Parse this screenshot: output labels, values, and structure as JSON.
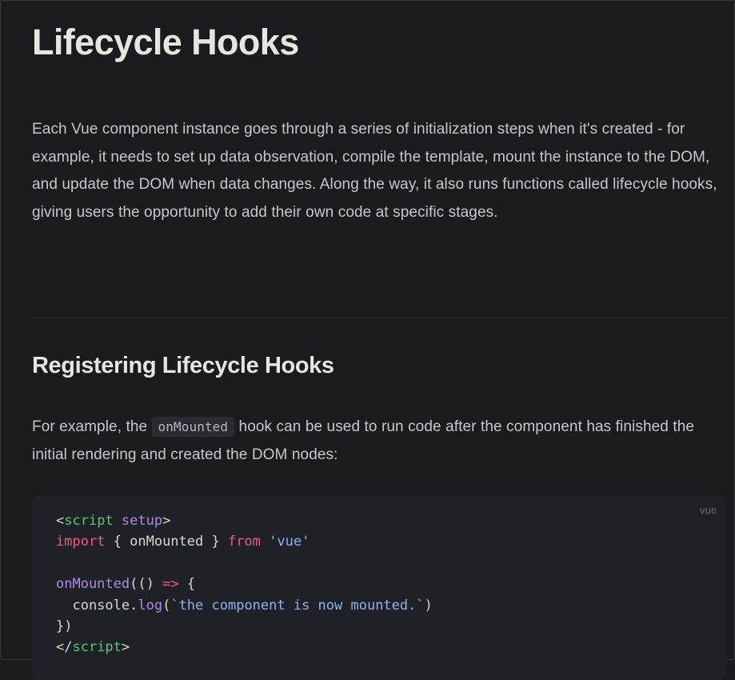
{
  "page": {
    "title": "Lifecycle Hooks",
    "intro": "Each Vue component instance goes through a series of initialization steps when it's created - for example, it needs to set up data observation, compile the template, mount the instance to the DOM, and update the DOM when data changes. Along the way, it also runs functions called lifecycle hooks, giving users the opportunity to add their own code at specific stages."
  },
  "section": {
    "heading": "Registering Lifecycle Hooks",
    "text_before": "For example, the ",
    "inline_code": "onMounted",
    "text_after": " hook can be used to run code after the component has finished the initial rendering and created the DOM nodes:"
  },
  "code_block": {
    "language": "vue",
    "lines": {
      "l1": {
        "open": "<",
        "tag": "script",
        "space": " ",
        "attr": "setup",
        "close": ">"
      },
      "l2": {
        "kw1": "import",
        "mid": " { onMounted } ",
        "kw2": "from",
        "sp": " ",
        "str": "'vue'"
      },
      "l4": {
        "fn": "onMounted",
        "p1": "(() ",
        "arrow": "=>",
        "p2": " {"
      },
      "l5": {
        "indent": "  console.",
        "fn": "log",
        "p1": "(",
        "str": "`the component is now mounted.`",
        "p2": ")"
      },
      "l6": {
        "text": "})"
      },
      "l7": {
        "open": "</",
        "tag": "script",
        "close": ">"
      }
    }
  }
}
